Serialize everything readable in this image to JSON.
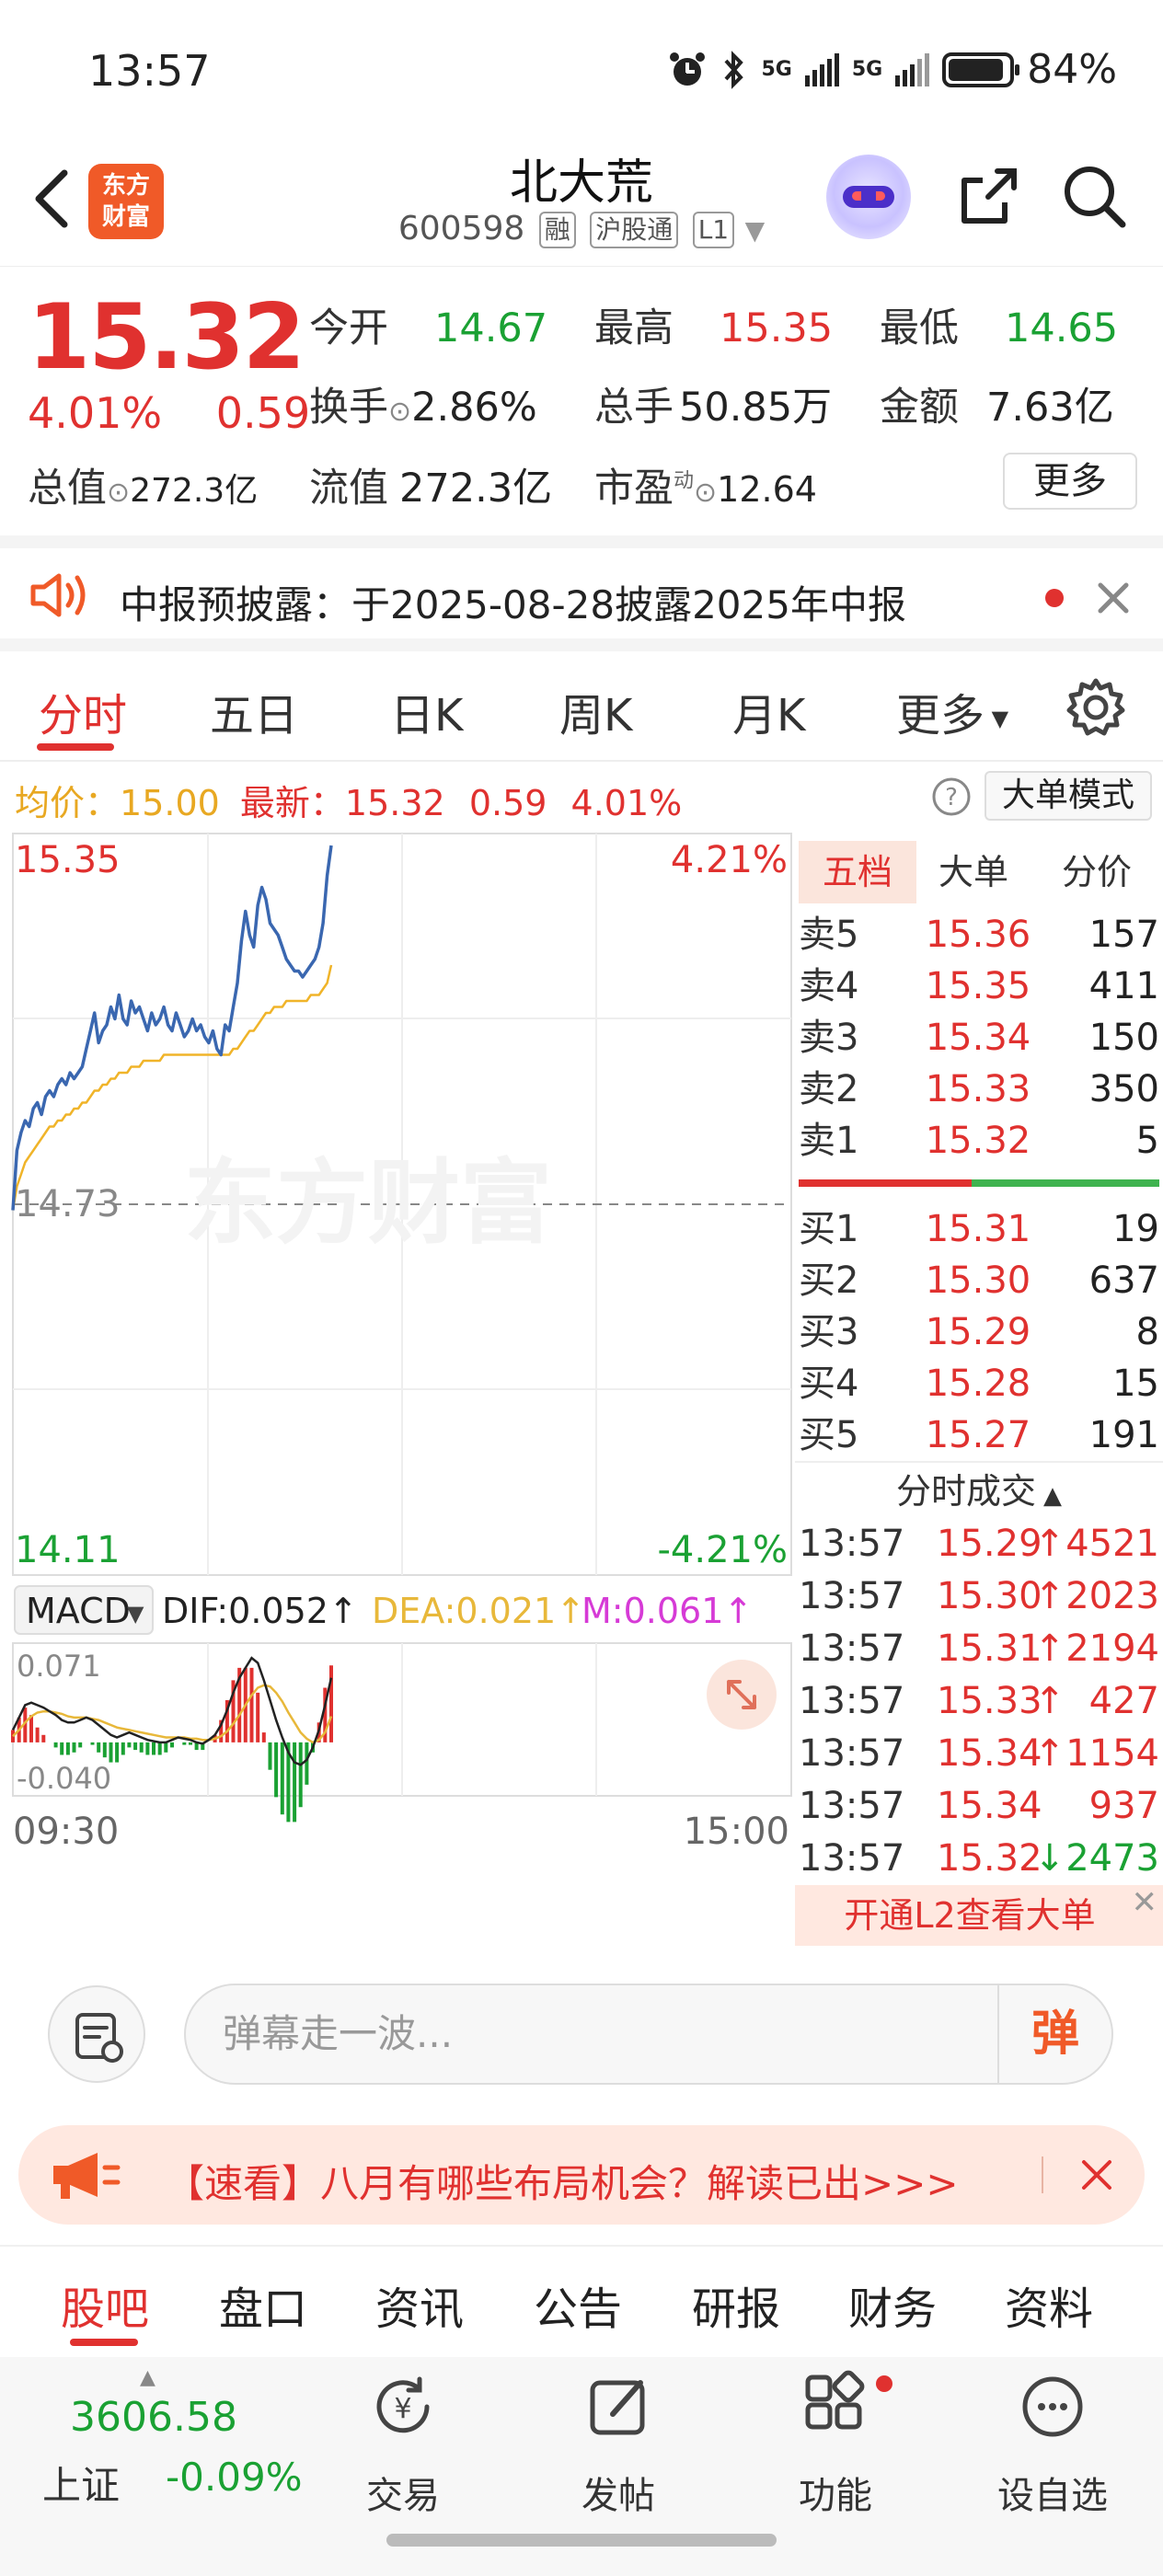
{
  "status_bar": {
    "time": "13:57",
    "battery": "84%",
    "net1": "5G",
    "net2": "5G"
  },
  "header": {
    "logo_text_1": "东方",
    "logo_text_2": "财富",
    "stock_name": "北大荒",
    "stock_code": "600598",
    "tags": [
      "融",
      "沪股通",
      "L1"
    ]
  },
  "quote": {
    "price": "15.32",
    "change_pct": "4.01%",
    "change_amt": "0.59",
    "open_label": "今开",
    "open": "14.67",
    "high_label": "最高",
    "high": "15.35",
    "low_label": "最低",
    "low": "14.65",
    "turnover_label": "换手",
    "turnover": "2.86%",
    "volume_label": "总手",
    "volume": "50.85万",
    "amount_label": "金额",
    "amount": "7.63亿",
    "mcap_label": "总值",
    "mcap": "272.3亿",
    "float_label": "流值",
    "float": "272.3亿",
    "pe_label": "市盈",
    "pe_sup": "动",
    "pe": "12.64",
    "more_label": "更多"
  },
  "notice": {
    "text": "中报预披露：于2025-08-28披露2025年中报"
  },
  "tabs": [
    "分时",
    "五日",
    "日K",
    "周K",
    "月K",
    "更多"
  ],
  "info_bar": {
    "avg_label": "均价：",
    "avg": "15.00",
    "latest_label": "最新：",
    "latest": "15.32",
    "chg": "0.59",
    "pct": "4.01%",
    "big_mode": "大单模式"
  },
  "chart_labels": {
    "top_price": "15.35",
    "top_pct": "4.21%",
    "mid_price": "14.73",
    "bottom_price": "14.11",
    "bottom_pct": "-4.21%",
    "watermark": "东方财富",
    "macd_label": "MACD",
    "dif": "DIF:0.052",
    "dea": "DEA:0.021",
    "m": "M:0.061",
    "macd_top": "0.071",
    "macd_bottom": "-0.040",
    "time_start": "09:30",
    "time_end": "15:00"
  },
  "chart_data": {
    "type": "line",
    "x_range": [
      "09:30",
      "15:00"
    ],
    "ylim": [
      14.11,
      15.35
    ],
    "prev_close": 14.73,
    "series": [
      {
        "values": [
          14.72,
          14.82,
          14.85,
          14.87,
          14.86,
          14.89,
          14.9,
          14.88,
          14.91,
          14.92,
          14.91,
          14.93,
          14.94,
          14.93,
          14.95,
          14.94,
          14.95,
          14.96,
          14.99,
          15.02,
          15.05,
          15.0,
          15.02,
          15.03,
          15.06,
          15.04,
          15.08,
          15.04,
          15.03,
          15.07,
          15.05,
          15.06,
          15.04,
          15.02,
          15.05,
          15.03,
          15.04,
          15.06,
          15.03,
          15.02,
          15.05,
          15.03,
          15.01,
          15.02,
          15.04,
          15.02,
          15.03,
          15.01,
          15.0,
          15.02,
          14.99,
          14.98,
          15.03,
          15.02,
          15.06,
          15.1,
          15.17,
          15.22,
          15.18,
          15.16,
          15.23,
          15.26,
          15.24,
          15.2,
          15.19,
          15.18,
          15.16,
          15.14,
          15.13,
          15.12,
          15.12,
          15.11,
          15.12,
          15.13,
          15.14,
          15.16,
          15.2,
          15.28,
          15.33
        ]
      },
      {
        "values": [
          14.72,
          14.76,
          14.78,
          14.8,
          14.81,
          14.82,
          14.83,
          14.84,
          14.85,
          14.86,
          14.86,
          14.87,
          14.87,
          14.88,
          14.88,
          14.89,
          14.89,
          14.9,
          14.9,
          14.91,
          14.92,
          14.92,
          14.93,
          14.93,
          14.94,
          14.94,
          14.95,
          14.95,
          14.95,
          14.96,
          14.96,
          14.96,
          14.97,
          14.97,
          14.97,
          14.97,
          14.97,
          14.98,
          14.98,
          14.98,
          14.98,
          14.98,
          14.98,
          14.98,
          14.98,
          14.98,
          14.98,
          14.98,
          14.98,
          14.98,
          14.98,
          14.98,
          14.98,
          14.98,
          14.99,
          14.99,
          15.0,
          15.01,
          15.02,
          15.02,
          15.03,
          15.04,
          15.05,
          15.05,
          15.06,
          15.06,
          15.06,
          15.07,
          15.07,
          15.07,
          15.07,
          15.07,
          15.07,
          15.08,
          15.08,
          15.08,
          15.09,
          15.1,
          15.13
        ]
      }
    ],
    "macd": {
      "ylim": [
        -0.04,
        0.071
      ],
      "dif": [
        0.01,
        0.02,
        0.03,
        0.032,
        0.03,
        0.028,
        0.025,
        0.022,
        0.018,
        0.016,
        0.016,
        0.018,
        0.02,
        0.018,
        0.014,
        0.01,
        0.006,
        0.004,
        0.006,
        0.008,
        0.006,
        0.004,
        0.002,
        0.001,
        0.0,
        0.0,
        0.002,
        0.004,
        0.003,
        0.002,
        0.0,
        -0.001,
        0.002,
        0.006,
        0.014,
        0.026,
        0.04,
        0.052,
        0.06,
        0.068,
        0.064,
        0.05,
        0.034,
        0.018,
        0.004,
        -0.008,
        -0.016,
        -0.018,
        -0.014,
        -0.004,
        0.01,
        0.03,
        0.052
      ],
      "dea": [
        0.005,
        0.01,
        0.016,
        0.021,
        0.024,
        0.025,
        0.025,
        0.024,
        0.023,
        0.021,
        0.02,
        0.02,
        0.02,
        0.019,
        0.018,
        0.016,
        0.014,
        0.012,
        0.011,
        0.01,
        0.009,
        0.008,
        0.007,
        0.006,
        0.005,
        0.004,
        0.004,
        0.004,
        0.004,
        0.003,
        0.003,
        0.002,
        0.002,
        0.003,
        0.005,
        0.009,
        0.015,
        0.022,
        0.03,
        0.038,
        0.044,
        0.046,
        0.045,
        0.04,
        0.033,
        0.024,
        0.016,
        0.008,
        0.003,
        0.0,
        0.002,
        0.008,
        0.021
      ],
      "hist": [
        0.01,
        0.02,
        0.028,
        0.022,
        0.012,
        0.006,
        0.0,
        -0.004,
        -0.01,
        -0.01,
        -0.008,
        -0.004,
        0.0,
        -0.002,
        -0.008,
        -0.012,
        -0.016,
        -0.016,
        -0.01,
        -0.004,
        -0.006,
        -0.008,
        -0.01,
        -0.01,
        -0.01,
        -0.008,
        -0.004,
        0.0,
        -0.002,
        -0.002,
        -0.006,
        -0.006,
        0.0,
        0.006,
        0.018,
        0.034,
        0.05,
        0.06,
        0.06,
        0.06,
        0.04,
        0.008,
        -0.022,
        -0.044,
        -0.058,
        -0.064,
        -0.064,
        -0.052,
        -0.034,
        -0.008,
        0.016,
        0.044,
        0.062
      ]
    }
  },
  "orderbook": {
    "tabs": [
      "五档",
      "大单",
      "分价"
    ],
    "asks": [
      {
        "label": "卖5",
        "price": "15.36",
        "vol": "157"
      },
      {
        "label": "卖4",
        "price": "15.35",
        "vol": "411"
      },
      {
        "label": "卖3",
        "price": "15.34",
        "vol": "150"
      },
      {
        "label": "卖2",
        "price": "15.33",
        "vol": "350"
      },
      {
        "label": "卖1",
        "price": "15.32",
        "vol": "5"
      }
    ],
    "bids": [
      {
        "label": "买1",
        "price": "15.31",
        "vol": "19"
      },
      {
        "label": "买2",
        "price": "15.30",
        "vol": "637"
      },
      {
        "label": "买3",
        "price": "15.29",
        "vol": "8"
      },
      {
        "label": "买4",
        "price": "15.28",
        "vol": "15"
      },
      {
        "label": "买5",
        "price": "15.27",
        "vol": "191"
      }
    ],
    "trades_title": "分时成交",
    "trades": [
      {
        "time": "13:57",
        "price": "15.29",
        "dir": "↑",
        "vol": "4521",
        "color": "#e0312f"
      },
      {
        "time": "13:57",
        "price": "15.30",
        "dir": "↑",
        "vol": "2023",
        "color": "#e0312f"
      },
      {
        "time": "13:57",
        "price": "15.31",
        "dir": "↑",
        "vol": "2194",
        "color": "#e0312f"
      },
      {
        "time": "13:57",
        "price": "15.33",
        "dir": "↑",
        "vol": "427",
        "color": "#e0312f"
      },
      {
        "time": "13:57",
        "price": "15.34",
        "dir": "↑",
        "vol": "1154",
        "color": "#e0312f"
      },
      {
        "time": "13:57",
        "price": "15.34",
        "dir": "",
        "vol": "937",
        "color": "#e0312f"
      },
      {
        "time": "13:57",
        "price": "15.32",
        "dir": "↓",
        "vol": "2473",
        "color": "#1aa133"
      }
    ],
    "l2_banner": "开通L2查看大单"
  },
  "danmu": {
    "placeholder": "弹幕走一波...",
    "send": "弹"
  },
  "promo": {
    "text": "【速看】八月有哪些布局机会？解读已出>>>"
  },
  "sub_tabs": [
    "股吧",
    "盘口",
    "资讯",
    "公告",
    "研报",
    "财务",
    "资料"
  ],
  "bottom_nav": {
    "index_value": "3606.58",
    "index_name": "上证",
    "index_change": "-0.09%",
    "items": [
      "交易",
      "发帖",
      "功能",
      "设自选"
    ]
  },
  "colors": {
    "up": "#e0312f",
    "down": "#1aa133",
    "price_line": "#3a67b0",
    "avg_line": "#f0b429",
    "dea_line": "#e8b83a",
    "m_color": "#d63ad6"
  }
}
